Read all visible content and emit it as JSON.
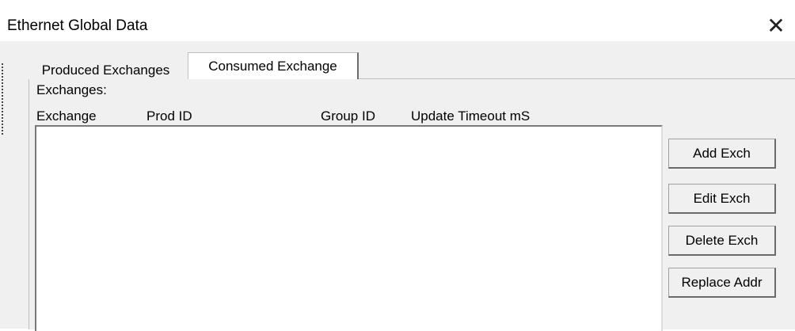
{
  "window": {
    "title": "Ethernet Global Data",
    "close_glyph": "✕"
  },
  "tabs": [
    {
      "label": "Produced Exchanges",
      "selected": false
    },
    {
      "label": "Consumed Exchange",
      "selected": true
    }
  ],
  "panel": {
    "exchanges_label": "Exchanges:",
    "columns": [
      "Exchange",
      "Prod ID",
      "Group ID",
      "Update Timeout mS"
    ],
    "rows": []
  },
  "buttons": {
    "add": "Add Exch",
    "edit": "Edit Exch",
    "delete": "Delete Exch",
    "replace": "Replace Addr"
  },
  "icons": {
    "close": "close-icon"
  }
}
